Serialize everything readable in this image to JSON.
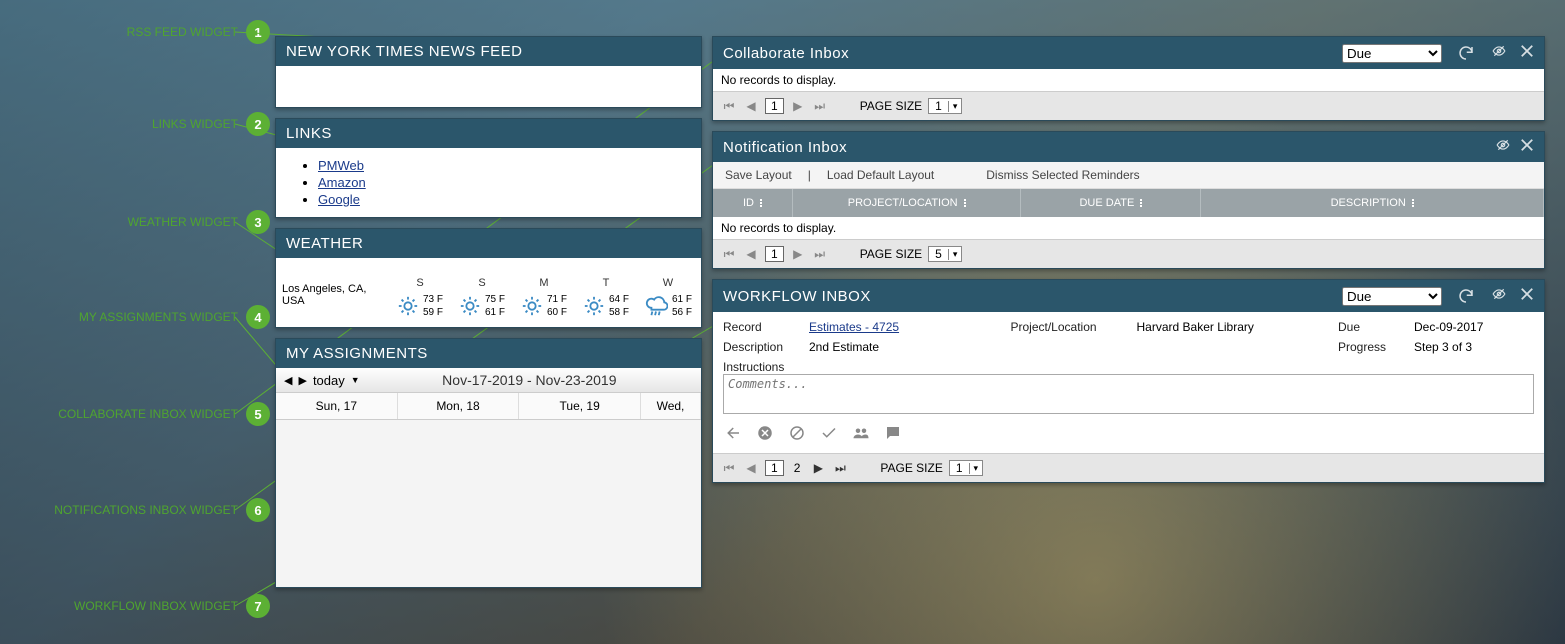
{
  "annotations": [
    {
      "n": "1",
      "label": "RSS FEED WIDGET"
    },
    {
      "n": "2",
      "label": "LINKS WIDGET"
    },
    {
      "n": "3",
      "label": "WEATHER WIDGET"
    },
    {
      "n": "4",
      "label": "MY ASSIGNMENTS WIDGET"
    },
    {
      "n": "5",
      "label": "COLLABORATE INBOX WIDGET"
    },
    {
      "n": "6",
      "label": "NOTIFICATIONS INBOX WIDGET"
    },
    {
      "n": "7",
      "label": "WORKFLOW INBOX WIDGET"
    }
  ],
  "rss": {
    "title": "NEW YORK TIMES NEWS FEED"
  },
  "links": {
    "title": "LINKS",
    "items": [
      "PMWeb",
      "Amazon",
      "Google"
    ]
  },
  "weather": {
    "title": "WEATHER",
    "location": "Los Angeles, CA, USA",
    "days": [
      {
        "d": "S",
        "hi": "73 F",
        "lo": "59 F",
        "icon": "sun"
      },
      {
        "d": "S",
        "hi": "75 F",
        "lo": "61 F",
        "icon": "sun"
      },
      {
        "d": "M",
        "hi": "71 F",
        "lo": "60 F",
        "icon": "sun"
      },
      {
        "d": "T",
        "hi": "64 F",
        "lo": "58 F",
        "icon": "sun"
      },
      {
        "d": "W",
        "hi": "61 F",
        "lo": "56 F",
        "icon": "rain"
      }
    ]
  },
  "assignments": {
    "title": "MY ASSIGNMENTS",
    "today": "today",
    "range": "Nov-17-2019 - Nov-23-2019",
    "cols": [
      "Sun, 17",
      "Mon, 18",
      "Tue, 19",
      "Wed,"
    ]
  },
  "collab": {
    "title": "Collaborate Inbox",
    "sort": "Due",
    "empty": "No records to display.",
    "page": "1",
    "page_size_label": "PAGE SIZE",
    "page_size": "1"
  },
  "notif": {
    "title": "Notification Inbox",
    "actions": {
      "save": "Save Layout",
      "load": "Load Default Layout",
      "dismiss": "Dismiss Selected Reminders"
    },
    "cols": [
      "ID",
      "PROJECT/LOCATION",
      "DUE DATE",
      "DESCRIPTION"
    ],
    "empty": "No records to display.",
    "page": "1",
    "page_size_label": "PAGE SIZE",
    "page_size": "5"
  },
  "workflow": {
    "title": "WORKFLOW INBOX",
    "sort": "Due",
    "labels": {
      "record": "Record",
      "project": "Project/Location",
      "due": "Due",
      "description": "Description",
      "progress": "Progress",
      "instructions": "Instructions"
    },
    "record_link": "Estimates - 4725",
    "project": "Harvard Baker Library",
    "due": "Dec-09-2017",
    "description": "2nd Estimate",
    "progress": "Step 3 of 3",
    "comments_placeholder": "Comments...",
    "page": "1",
    "page2": "2",
    "page_size_label": "PAGE SIZE",
    "page_size": "1"
  }
}
